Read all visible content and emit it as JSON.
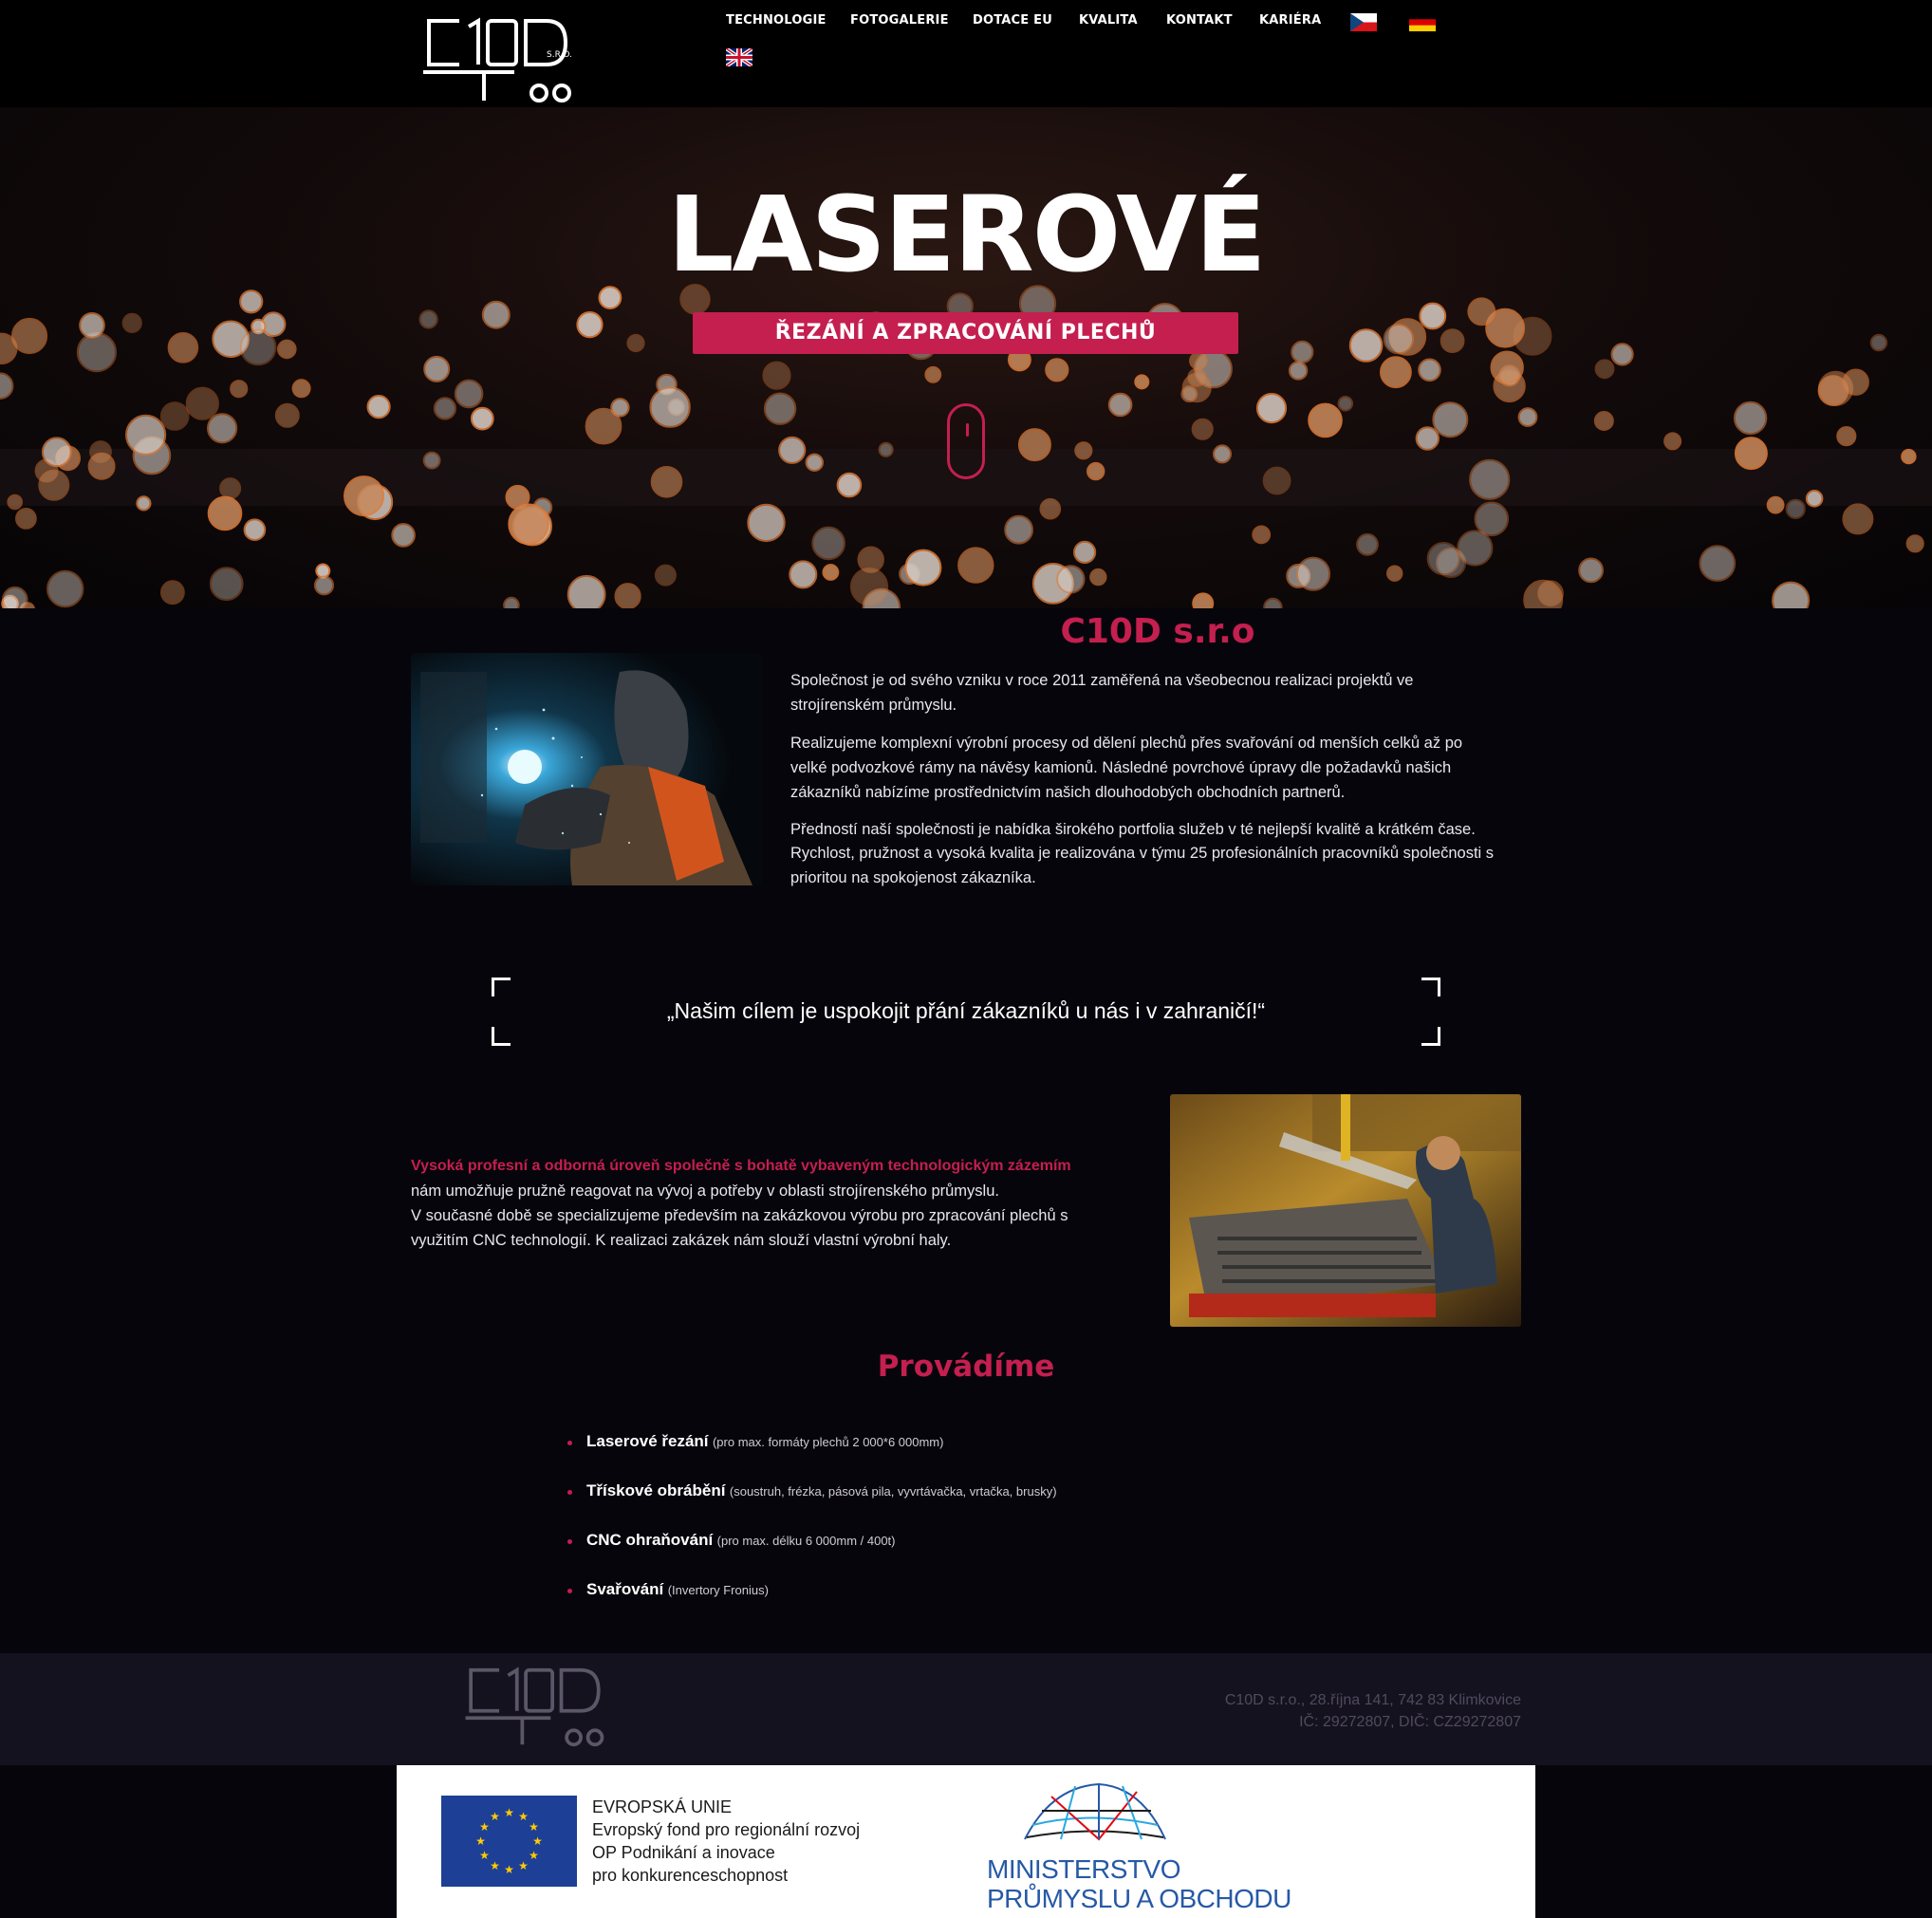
{
  "brand": {
    "logo_text": "C10D",
    "logo_suffix": "S.R.O."
  },
  "nav": {
    "items": [
      "TECHNOLOGIE",
      "FOTOGALERIE",
      "DOTACE EU",
      "KVALITA",
      "KONTAKT",
      "KARIÉRA"
    ],
    "languages": [
      "cz-flag-icon",
      "de-flag-icon",
      "gb-flag-icon"
    ]
  },
  "hero": {
    "title": "LASEROVÉ",
    "subtitle": "ŘEZÁNÍ A ZPRACOVÁNÍ PLECHŮ",
    "accent_color": "#c41f4f"
  },
  "about": {
    "title": "C10D s.r.o",
    "p1": "Společnost je od svého vzniku v roce 2011 zaměřená na všeobecnou realizaci projektů ve strojírenském průmyslu.",
    "p2": "Realizujeme komplexní výrobní procesy od dělení plechů přes svařování od menších celků až po velké podvozkové rámy na návěsy kamionů. Následné povrchové úpravy dle požadavků našich zákazníků nabízíme prostřednictvím našich dlouhodobých obchodních partnerů.",
    "p3": "Předností naší společnosti je nabídka širokého portfolia služeb v té nejlepší kvalitě a krátkém čase.",
    "p4": "Rychlost, pružnost a vysoká kvalita je realizována v týmu 25 profesionálních pracovníků společnosti s prioritou na spokojenost zákazníka."
  },
  "quote": {
    "text": "„Našim cílem je uspokojit přání zákazníků u nás i v zahraničí!“"
  },
  "expertise": {
    "highlight": "Vysoká profesní a odborná úroveň společně s bohatě vybaveným technologickým zázemím",
    "line1": "nám umožňuje pružně reagovat na vývoj a potřeby v oblasti strojírenského průmyslu.",
    "line2": "V současné době se specializujeme především na zakázkovou výrobu pro zpracování plechů s využitím CNC technologií. K realizaci zakázek nám slouží vlastní výrobní haly."
  },
  "services": {
    "title": "Provádíme",
    "items": [
      {
        "name": "Laserové řezání",
        "detail": "(pro max. formáty plechů 2 000*6 000mm)"
      },
      {
        "name": "Třískové obrábění",
        "detail": "(soustruh, frézka, pásová pila, vyvrtávačka, vrtačka, brusky)"
      },
      {
        "name": "CNC ohraňování",
        "detail": "(pro max. délku 6 000mm / 400t)"
      },
      {
        "name": "Svařování",
        "detail": "(Invertory Fronius)"
      }
    ]
  },
  "footer": {
    "address": "C10D s.r.o., 28.října 141, 742 83 Klimkovice",
    "ids": "IČ: 29272807, DIČ: CZ29272807"
  },
  "eu": {
    "line1": "EVROPSKÁ UNIE",
    "line2": "Evropský fond pro regionální rozvoj",
    "line3": "OP Podnikání a inovace",
    "line4": "pro konkurenceschopnost",
    "ministry_line1": "MINISTERSTVO",
    "ministry_line2": "PRŮMYSLU A OBCHODU"
  }
}
